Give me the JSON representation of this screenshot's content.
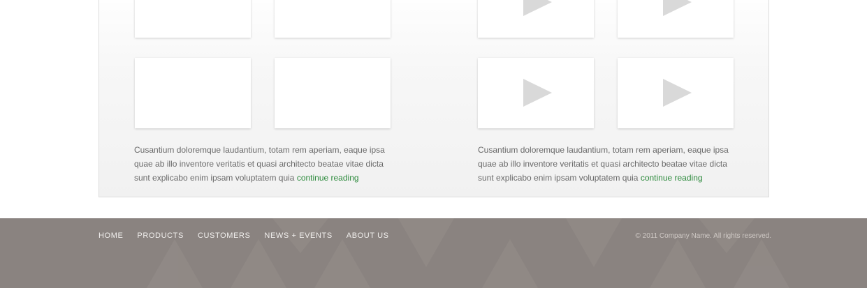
{
  "gallery": {
    "left": {
      "blurb": "Cusantium doloremque laudantium, totam rem aperiam, eaque ipsa quae ab illo inventore veritatis et quasi architecto beatae vitae dicta sunt explicabo enim ipsam voluptatem quia",
      "link": "continue reading"
    },
    "right": {
      "blurb": "Cusantium doloremque laudantium, totam rem aperiam, eaque ipsa quae ab illo inventore veritatis et quasi architecto beatae vitae dicta sunt explicabo enim ipsam voluptatem quia",
      "link": "continue reading"
    }
  },
  "footer": {
    "nav": [
      "HOME",
      "PRODUCTS",
      "CUSTOMERS",
      "NEWS + EVENTS",
      "ABOUT US"
    ],
    "copyright": "© 2011 Company Name. All rights reserved."
  },
  "colors": {
    "footer_bg": "#8a8380",
    "link_green": "#2c8a3c",
    "body_text": "#6a6a6a"
  },
  "icons": [
    "play-icon"
  ]
}
